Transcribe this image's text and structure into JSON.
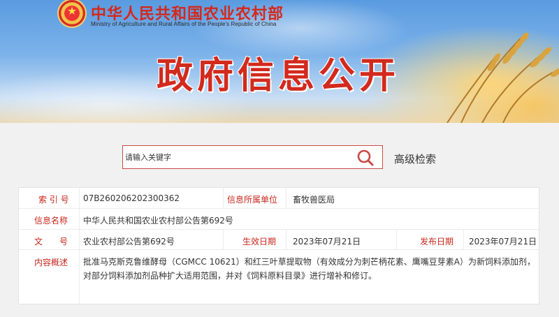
{
  "header": {
    "ministry_cn": "中华人民共和国农业农村部",
    "ministry_en": "Ministry of Agriculture and Rural Affairs of the People's Republic of China",
    "page_title": "政府信息公开"
  },
  "search": {
    "placeholder": "请输入关键字",
    "search_icon": "magnifier-icon",
    "advanced_label": "高级检索"
  },
  "info": {
    "index": {
      "label": "索 引 号",
      "value": "07B260206202300362"
    },
    "publisher": {
      "label": "信息所属单位",
      "value": "畜牧兽医局"
    },
    "title": {
      "label": "信息名称",
      "value": "中华人民共和国农业农村部公告第692号"
    },
    "doc_no": {
      "label": "文　　号",
      "value": "农业农村部公告第692号"
    },
    "effective": {
      "label": "生效日期",
      "value": "2023年07月21日"
    },
    "published": {
      "label": "发布日期",
      "value": "2023年07月21日"
    },
    "summary": {
      "label": "内容概述",
      "value": "批准马克斯克鲁维酵母（CGMCC 10621）和红三叶草提取物（有效成分为刺芒柄花素、鹰嘴豆芽素A）为新饲料添加剂，对部分饲料添加剂品种扩大适用范围，并对《饲料原料目录》进行增补和修订。"
    }
  },
  "colors": {
    "accent_red": "#c8281d",
    "title_red": "#d22a1d",
    "emblem_gold": "#f2c24a"
  }
}
